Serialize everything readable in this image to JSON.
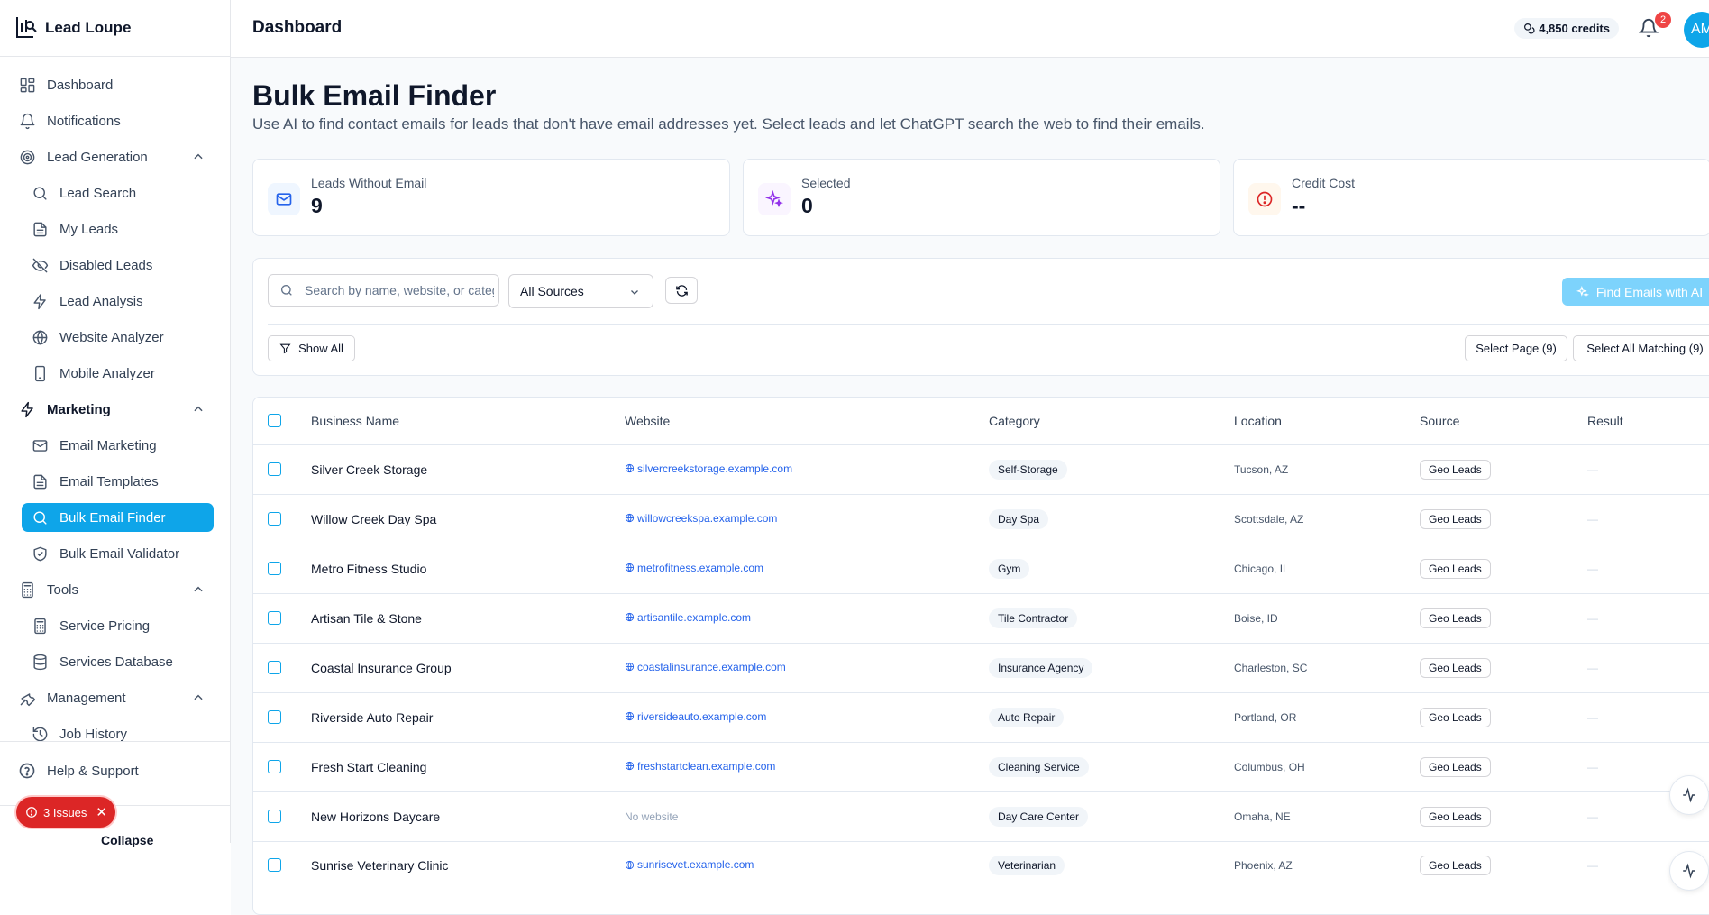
{
  "app": {
    "name": "Lead Loupe"
  },
  "header": {
    "title": "Dashboard",
    "credits": "4,850 credits",
    "notification_count": "2",
    "avatar_initials": "AM"
  },
  "sidebar": {
    "items": [
      {
        "label": "Dashboard",
        "icon": "grid-icon",
        "type": "top"
      },
      {
        "label": "Notifications",
        "icon": "bell-icon",
        "type": "top"
      },
      {
        "label": "Lead Generation",
        "icon": "target-icon",
        "type": "group"
      },
      {
        "label": "Lead Search",
        "icon": "search-icon",
        "type": "sub"
      },
      {
        "label": "My Leads",
        "icon": "file-icon",
        "type": "sub"
      },
      {
        "label": "Disabled Leads",
        "icon": "eye-off-icon",
        "type": "sub"
      },
      {
        "label": "Lead Analysis",
        "icon": "bolt-icon",
        "type": "sub"
      },
      {
        "label": "Website Analyzer",
        "icon": "globe-icon",
        "type": "sub"
      },
      {
        "label": "Mobile Analyzer",
        "icon": "phone-icon",
        "type": "sub"
      },
      {
        "label": "Marketing",
        "icon": "bolt-icon",
        "type": "group-strong"
      },
      {
        "label": "Email Marketing",
        "icon": "mail-icon",
        "type": "sub"
      },
      {
        "label": "Email Templates",
        "icon": "file-icon",
        "type": "sub"
      },
      {
        "label": "Bulk Email Finder",
        "icon": "search-icon",
        "type": "active"
      },
      {
        "label": "Bulk Email Validator",
        "icon": "shield-check-icon",
        "type": "sub"
      },
      {
        "label": "Tools",
        "icon": "calculator-icon",
        "type": "group"
      },
      {
        "label": "Service Pricing",
        "icon": "calculator-icon",
        "type": "sub"
      },
      {
        "label": "Services Database",
        "icon": "database-icon",
        "type": "sub"
      },
      {
        "label": "Management",
        "icon": "wrench-icon",
        "type": "group"
      },
      {
        "label": "Job History",
        "icon": "history-icon",
        "type": "sub"
      }
    ],
    "help_label": "Help & Support",
    "collapse_label": "Collapse",
    "issues_label": "3 Issues"
  },
  "page": {
    "heading": "Bulk Email Finder",
    "description": "Use AI to find contact emails for leads that don't have email addresses yet. Select leads and let ChatGPT search the web to find their emails."
  },
  "stats": [
    {
      "label": "Leads Without Email",
      "value": "9",
      "icon": "mail-icon",
      "color": "#2563eb",
      "bg": "#eff6ff"
    },
    {
      "label": "Selected",
      "value": "0",
      "icon": "sparkles-icon",
      "color": "#9333ea",
      "bg": "#faf5ff"
    },
    {
      "label": "Credit Cost",
      "value": "--",
      "icon": "alert-circle-icon",
      "color": "#dc2626",
      "bg": "#fff7ed"
    }
  ],
  "toolbar": {
    "search_placeholder": "Search by name, website, or category...",
    "source_selected": "All Sources",
    "find_button": "Find Emails with AI",
    "show_all": "Show All",
    "select_page": "Select Page (9)",
    "select_all_matching": "Select All Matching (9)"
  },
  "table": {
    "columns": [
      "Business Name",
      "Website",
      "Category",
      "Location",
      "Source",
      "Result"
    ],
    "rows": [
      {
        "name": "Silver Creek Storage",
        "website": "silvercreekstorage.example.com",
        "category": "Self-Storage",
        "location": "Tucson, AZ",
        "source": "Geo Leads",
        "result": "—"
      },
      {
        "name": "Willow Creek Day Spa",
        "website": "willowcreekspa.example.com",
        "category": "Day Spa",
        "location": "Scottsdale, AZ",
        "source": "Geo Leads",
        "result": "—"
      },
      {
        "name": "Metro Fitness Studio",
        "website": "metrofitness.example.com",
        "category": "Gym",
        "location": "Chicago, IL",
        "source": "Geo Leads",
        "result": "—"
      },
      {
        "name": "Artisan Tile & Stone",
        "website": "artisantile.example.com",
        "category": "Tile Contractor",
        "location": "Boise, ID",
        "source": "Geo Leads",
        "result": "—"
      },
      {
        "name": "Coastal Insurance Group",
        "website": "coastalinsurance.example.com",
        "category": "Insurance Agency",
        "location": "Charleston, SC",
        "source": "Geo Leads",
        "result": "—"
      },
      {
        "name": "Riverside Auto Repair",
        "website": "riversideauto.example.com",
        "category": "Auto Repair",
        "location": "Portland, OR",
        "source": "Geo Leads",
        "result": "—"
      },
      {
        "name": "Fresh Start Cleaning",
        "website": "freshstartclean.example.com",
        "category": "Cleaning Service",
        "location": "Columbus, OH",
        "source": "Geo Leads",
        "result": "—"
      },
      {
        "name": "New Horizons Daycare",
        "website": "",
        "no_website_label": "No website",
        "category": "Day Care Center",
        "location": "Omaha, NE",
        "source": "Geo Leads",
        "result": "—"
      },
      {
        "name": "Sunrise Veterinary Clinic",
        "website": "sunrisevet.example.com",
        "category": "Veterinarian",
        "location": "Phoenix, AZ",
        "source": "Geo Leads",
        "result": "—"
      }
    ]
  }
}
